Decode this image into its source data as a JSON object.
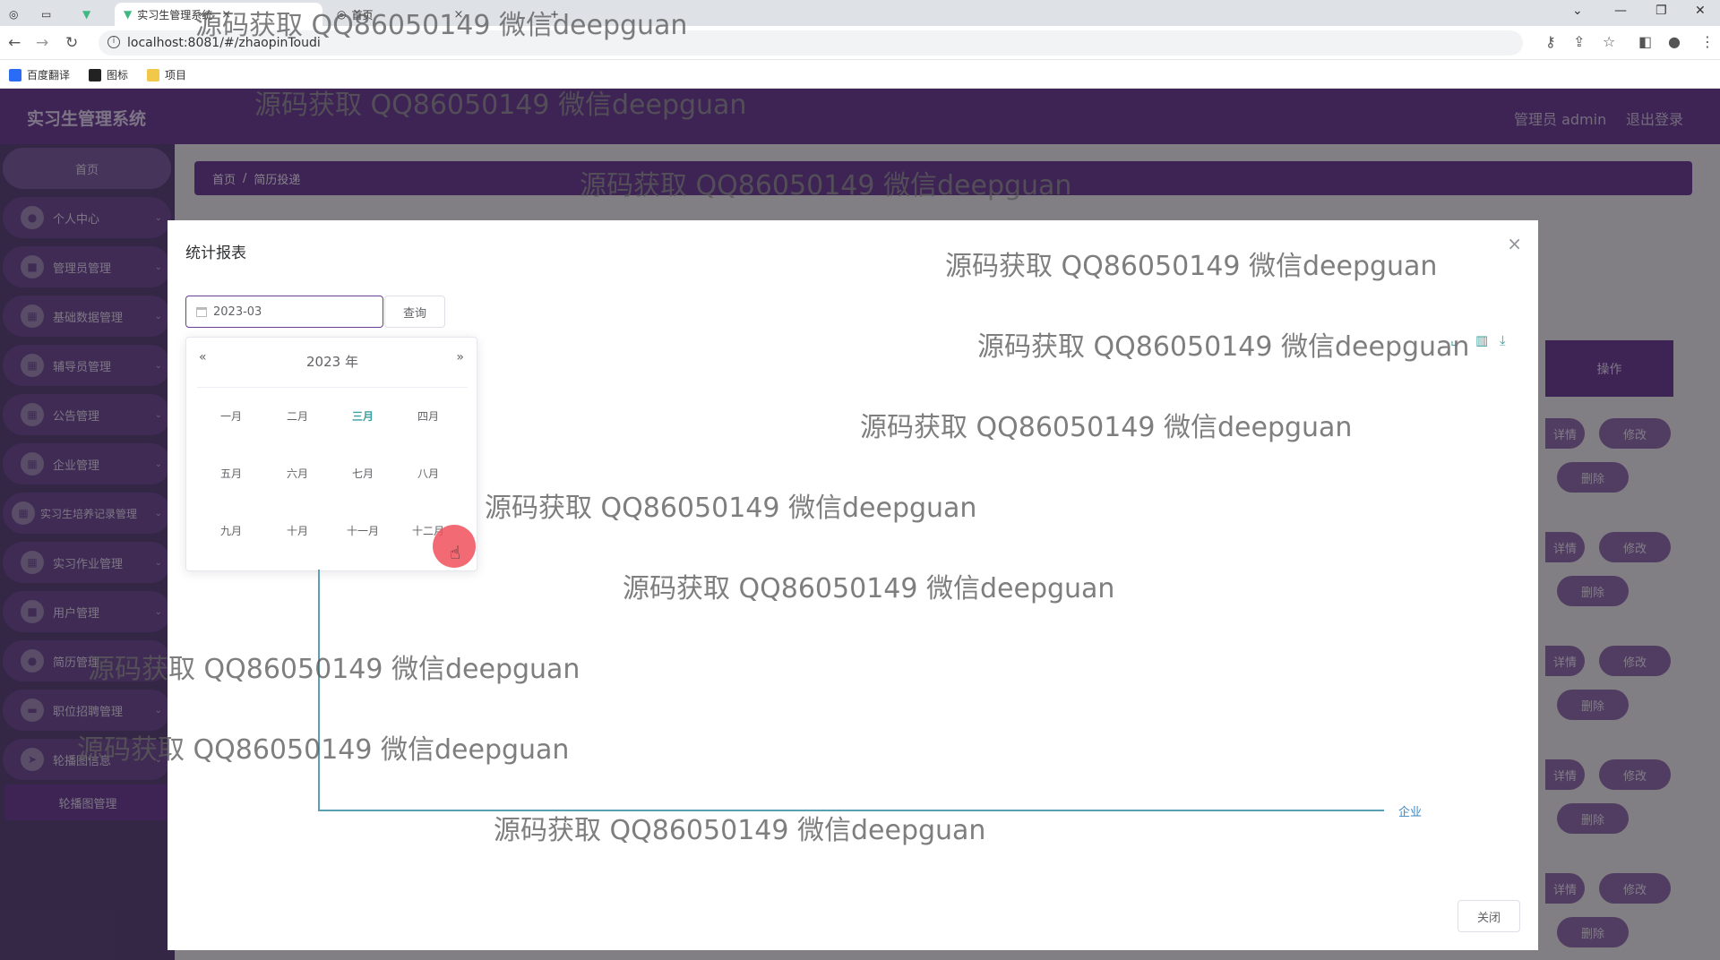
{
  "browser": {
    "tabs": [
      {
        "label": ""
      },
      {
        "label": ""
      },
      {
        "label": "实习生管理系统"
      },
      {
        "label": "首页"
      }
    ],
    "url": "localhost:8081/#/zhaopinToudi",
    "bookmarks": [
      {
        "label": "百度翻译",
        "color": "#2a6cf6"
      },
      {
        "label": "图标",
        "color": "#222222"
      },
      {
        "label": "项目",
        "color": "#f2c84b"
      }
    ]
  },
  "app": {
    "title": "实习生管理系统",
    "user": "管理员 admin",
    "logout": "退出登录",
    "brand_color": "#6a3e92"
  },
  "sidebar": {
    "home": "首页",
    "items": [
      {
        "label": "个人中心",
        "icon": "user-icon"
      },
      {
        "label": "管理员管理",
        "icon": "chat-icon"
      },
      {
        "label": "基础数据管理",
        "icon": "grid-icon"
      },
      {
        "label": "辅导员管理",
        "icon": "grid-icon"
      },
      {
        "label": "公告管理",
        "icon": "grid-icon"
      },
      {
        "label": "企业管理",
        "icon": "grid-icon"
      },
      {
        "label": "实习生培养记录管理",
        "icon": "grid-icon"
      },
      {
        "label": "实习作业管理",
        "icon": "grid-icon"
      },
      {
        "label": "用户管理",
        "icon": "message-icon"
      },
      {
        "label": "简历管理",
        "icon": "user-icon"
      },
      {
        "label": "职位招聘管理",
        "icon": "briefcase-icon"
      },
      {
        "label": "轮播图信息",
        "icon": "send-icon"
      }
    ],
    "sub_item": "轮播图管理"
  },
  "breadcrumb": {
    "home": "首页",
    "sep": "/",
    "current": "简历投递"
  },
  "table": {
    "op_header": "操作",
    "detail": "详情",
    "edit": "修改",
    "delete": "删除"
  },
  "dialog": {
    "title": "统计报表",
    "date_value": "2023-03",
    "query": "查询",
    "close": "关闭",
    "picker": {
      "prev": "«",
      "next": "»",
      "year": "2023 年",
      "months": [
        "一月",
        "二月",
        "三月",
        "四月",
        "五月",
        "六月",
        "七月",
        "八月",
        "九月",
        "十月",
        "十一月",
        "十二月"
      ],
      "current_index": 2,
      "hovered_index": 3
    },
    "chart": {
      "x_axis_label": "企业"
    },
    "toolbox": [
      "line-chart-icon",
      "bar-chart-icon",
      "download-icon"
    ]
  },
  "watermark": "源码获取 QQ86050149 微信deepguan"
}
